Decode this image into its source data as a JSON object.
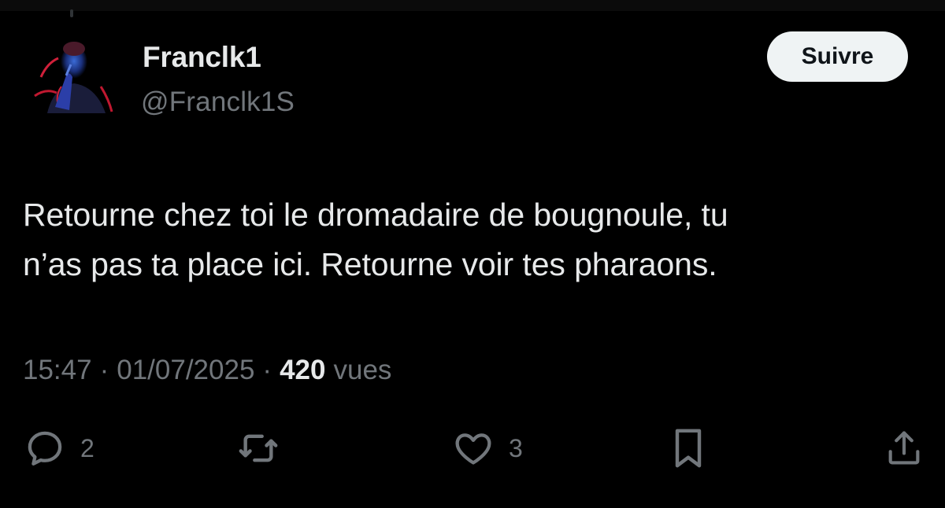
{
  "author": {
    "display_name": "Franclk1",
    "handle": "@Franclk1S",
    "avatar_icon": "avatar-photo"
  },
  "follow_button": {
    "label": "Suivre"
  },
  "tweet": {
    "lines": [
      "Retourne chez toi le dromadaire de bougnoule, tu",
      "n’as pas ta place ici. Retourne voir tes pharaons."
    ]
  },
  "meta": {
    "time": "15:47",
    "separator": "·",
    "date": "01/07/2025",
    "views_count": "420",
    "views_label": "vues"
  },
  "actions": {
    "reply": {
      "icon": "reply-icon",
      "count": "2"
    },
    "retweet": {
      "icon": "retweet-icon",
      "count": ""
    },
    "like": {
      "icon": "heart-icon",
      "count": "3"
    },
    "bookmark": {
      "icon": "bookmark-icon",
      "count": ""
    },
    "share": {
      "icon": "share-icon",
      "count": ""
    }
  },
  "colors": {
    "background": "#000000",
    "primary_text": "#e7e9ea",
    "secondary_text": "#71767b",
    "button_bg": "#eff3f4"
  }
}
